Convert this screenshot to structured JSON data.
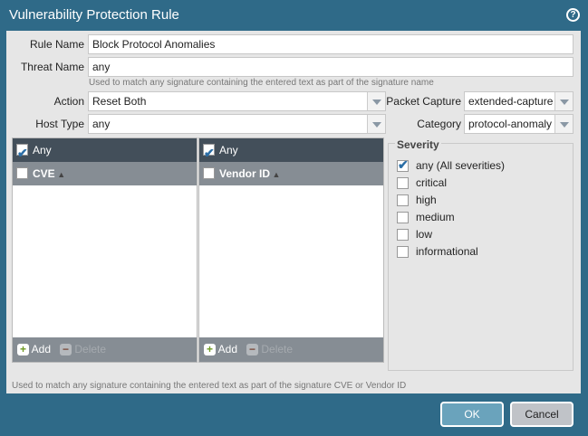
{
  "dialog": {
    "title": "Vulnerability Protection Rule"
  },
  "form": {
    "rule_name_label": "Rule Name",
    "rule_name": "Block Protocol Anomalies",
    "threat_name_label": "Threat Name",
    "threat_name": "any",
    "threat_hint": "Used to match any signature containing the entered text as part of the signature name",
    "action_label": "Action",
    "action": "Reset Both",
    "host_type_label": "Host Type",
    "host_type": "any",
    "packet_capture_label": "Packet Capture",
    "packet_capture": "extended-capture",
    "category_label": "Category",
    "category": "protocol-anomaly"
  },
  "cve_grid": {
    "any_label": "Any",
    "column": "CVE",
    "add": "Add",
    "delete": "Delete"
  },
  "vendor_grid": {
    "any_label": "Any",
    "column": "Vendor ID",
    "add": "Add",
    "delete": "Delete"
  },
  "severity": {
    "title": "Severity",
    "items": [
      {
        "label": "any (All severities)",
        "checked": true
      },
      {
        "label": "critical",
        "checked": false
      },
      {
        "label": "high",
        "checked": false
      },
      {
        "label": "medium",
        "checked": false
      },
      {
        "label": "low",
        "checked": false
      },
      {
        "label": "informational",
        "checked": false
      }
    ]
  },
  "footer_hint": "Used to match any signature containing the entered text as part of the signature CVE or Vendor ID",
  "buttons": {
    "ok": "OK",
    "cancel": "Cancel"
  }
}
